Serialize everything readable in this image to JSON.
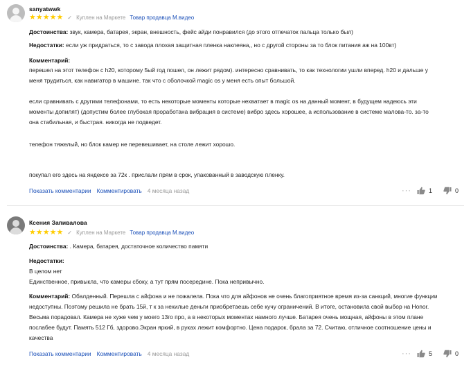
{
  "colors": {
    "star": "#ffcc00",
    "link": "#1a4fb8",
    "muted": "#999999"
  },
  "reviews": [
    {
      "author": "sanyatwwk",
      "stars": 5,
      "purchase": "Куплен на Маркете",
      "seller": "Товар продавца М.видео",
      "pros_label": "Достоинства:",
      "pros": "звук, камера, батарея, экран, внешность, фейс айди понравился (до этого отпечаток пальца только был)",
      "cons_label": "Недостатки:",
      "cons": "если уж придраться, то с завода плохая защитная пленка наклеяна,, но с другой стороны за то блок питания аж на 100вт)",
      "comment_label": "Комментарий:",
      "comment_lines": [
        "перешел на этот телефон с h20, которому 5ый год пошел, он лежит рядом). интересно сравнивать, то как технологии ушли вперед. h20 и дальше у",
        "меня трудиться, как навигатор в машине. так что с оболочкой magic os у меня есть опыт большой.",
        "",
        "если сравнивать с другими телефонами, то есть некоторые моменты которые нехватает в magic os на данный момент, в будущем надеюсь эти",
        "моменты допилят) (допустим более глубокая проработана вибрация в системе) вибро здесь хорошее, а использование в системе малова-то. за-то",
        "она стабильная, и быстрая. никогда не подведет.",
        "",
        "телефон тяжелый, но блок камер не перевешивает, на столе лежит хорошо.",
        "",
        "",
        "покупал его здесь на яндексе за 72к . прислали прям в срок, упакованный в заводскую пленку."
      ],
      "show_comments": "Показать комментарии",
      "comment_action": "Комментировать",
      "date": "4 месяца назад",
      "likes": "1",
      "dislikes": "0"
    },
    {
      "author": "Ксения Запивалова",
      "stars": 5,
      "purchase": "Куплен на Маркете",
      "seller": "Товар продавца М.видео",
      "pros_label": "Достоинства:",
      "pros": ". Камера, батарея, достаточное количество памяти",
      "cons_label": "Недостатки:",
      "cons_lines": [
        "В целом нет",
        "Единственное, привыкла, что камеры сбоку, а тут прям посередине. Пока непривычно."
      ],
      "comment_label": "Комментарий:",
      "comment_lines": [
        "Обалденный. Перешла с айфона и не пожалела. Пока что для айфонов не очень благоприятное время из-за санкций, многие функции",
        "недоступны. Поэтому решила не брать 15й, т к за нехилые деньги приобретаешь себе кучу ограничений. В итоге, остановила свой выбор на Honor.",
        "Весьма порадовал. Камера не хуже чем у моего 13го про, а в некоторых моментах намного лучше. Батарея очень мощная, айфоны в этом плане",
        "послабее будут. Память 512 Гб, здорово.Экран яркий, в руках лежит комфортно. Цена подарок, брала за 72. Считаю, отличное соотношение цены и",
        "качества"
      ],
      "show_comments": "Показать комментарии",
      "comment_action": "Комментировать",
      "date": "4 месяца назад",
      "likes": "5",
      "dislikes": "0"
    }
  ]
}
